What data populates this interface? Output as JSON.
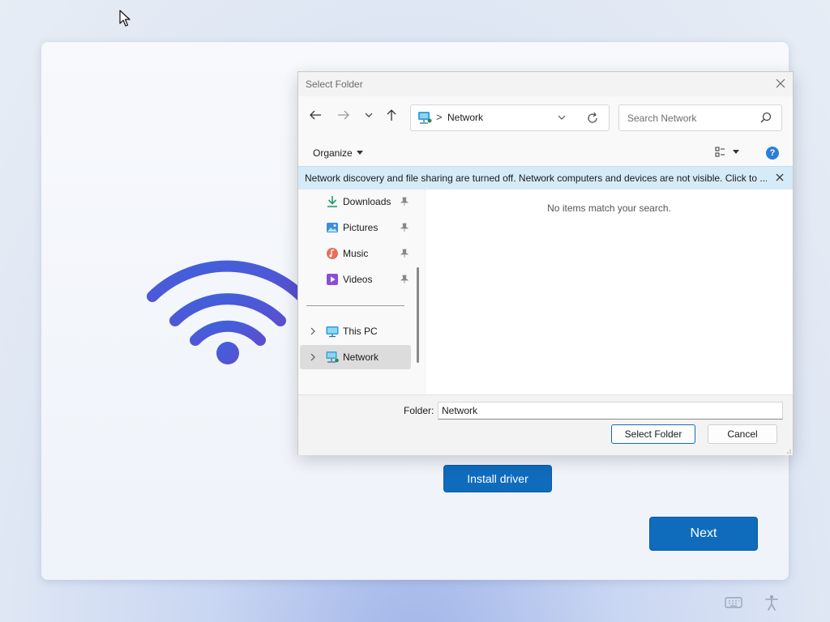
{
  "background_page": {
    "install_button": "Install driver",
    "next_button": "Next",
    "colors": {
      "accent": "#0f6cbd",
      "wifi_gradient_start": "#3f5fd8",
      "wifi_gradient_end": "#5b4fd0"
    }
  },
  "dialog": {
    "title": "Select Folder",
    "address": {
      "breadcrumb_separator": ">",
      "location": "Network"
    },
    "search": {
      "placeholder": "Search Network"
    },
    "command_bar": {
      "organize_label": "Organize",
      "help_label": "?"
    },
    "infobar": {
      "message": "Network discovery and file sharing are turned off. Network computers and devices are not visible. Click to ..."
    },
    "nav_items": [
      {
        "label": "Downloads",
        "icon": "download-icon",
        "pinned": true
      },
      {
        "label": "Pictures",
        "icon": "pictures-icon",
        "pinned": true
      },
      {
        "label": "Music",
        "icon": "music-icon",
        "pinned": true
      },
      {
        "label": "Videos",
        "icon": "videos-icon",
        "pinned": true
      },
      {
        "label": "This PC",
        "icon": "pc-icon",
        "expandable": true
      },
      {
        "label": "Network",
        "icon": "network-icon",
        "expandable": true,
        "selected": true
      }
    ],
    "content": {
      "empty_message": "No items match your search."
    },
    "footer": {
      "folder_label": "Folder:",
      "folder_value": "Network",
      "select_button": "Select Folder",
      "cancel_button": "Cancel"
    }
  }
}
